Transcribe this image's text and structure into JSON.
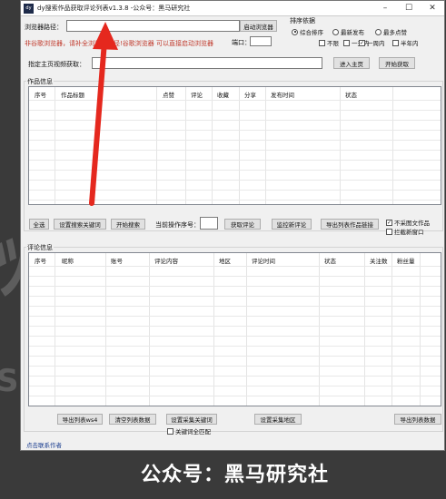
{
  "window": {
    "title": "dy搜索作品获取评论列表v1.3.8 -公众号：黑马研究社",
    "icon_text": "dy"
  },
  "browser": {
    "path_label": "浏览器路径：",
    "path_value": "",
    "start_button": "启动浏览器",
    "warning": "非谷歌浏览器，请补全浏览器路径!谷歌浏览器 可以直接启动浏览器",
    "port_label": "端口：",
    "port_value": ""
  },
  "sort": {
    "title": "排序依据",
    "options": [
      "综合排序",
      "最新发布",
      "最多点赞"
    ],
    "selected": "综合排序",
    "time_options": [
      "不限",
      "一天内",
      "一周内",
      "半年内"
    ],
    "time_checked": "一周内"
  },
  "homepage": {
    "label": "指定主页视频获取：",
    "value": "",
    "enter_button": "进入主页",
    "start_button": "开始获取"
  },
  "works": {
    "title": "作品信息",
    "columns": [
      "序号",
      "作品标题",
      "点赞",
      "评论",
      "收藏",
      "分享",
      "发布时间",
      "状态"
    ],
    "rows": []
  },
  "works_actions": {
    "select_all": "全选",
    "set_keywords": "设置搜索关键词",
    "start_search": "开始搜索",
    "current_index_label": "当前操作序号：",
    "current_index_value": "",
    "get_comments": "获取评论",
    "monitor_comments": "监控新评论",
    "export_links": "导出列表作品链接",
    "skip_image_text": "不采图文作品",
    "block_new_window": "拦截新窗口",
    "skip_image_text_checked": true,
    "block_new_window_checked": false
  },
  "comments": {
    "title": "评论信息",
    "columns": [
      "序号",
      "昵称",
      "账号",
      "评论内容",
      "地区",
      "评论时间",
      "状态",
      "关注数",
      "粉丝量"
    ],
    "rows": []
  },
  "bottom_actions": {
    "export_ws4": "导出列表ws4",
    "clear_list": "清空列表数据",
    "set_collect_keywords": "设置采集关键词",
    "set_collect_region": "设置采集地区",
    "export_list": "导出列表数据",
    "keyword_full_match": "关键词全匹配",
    "keyword_full_match_checked": false
  },
  "status_bar": {
    "contact": "点击联系作者"
  },
  "overlay": {
    "caption": "公众号：黑马研究社"
  }
}
